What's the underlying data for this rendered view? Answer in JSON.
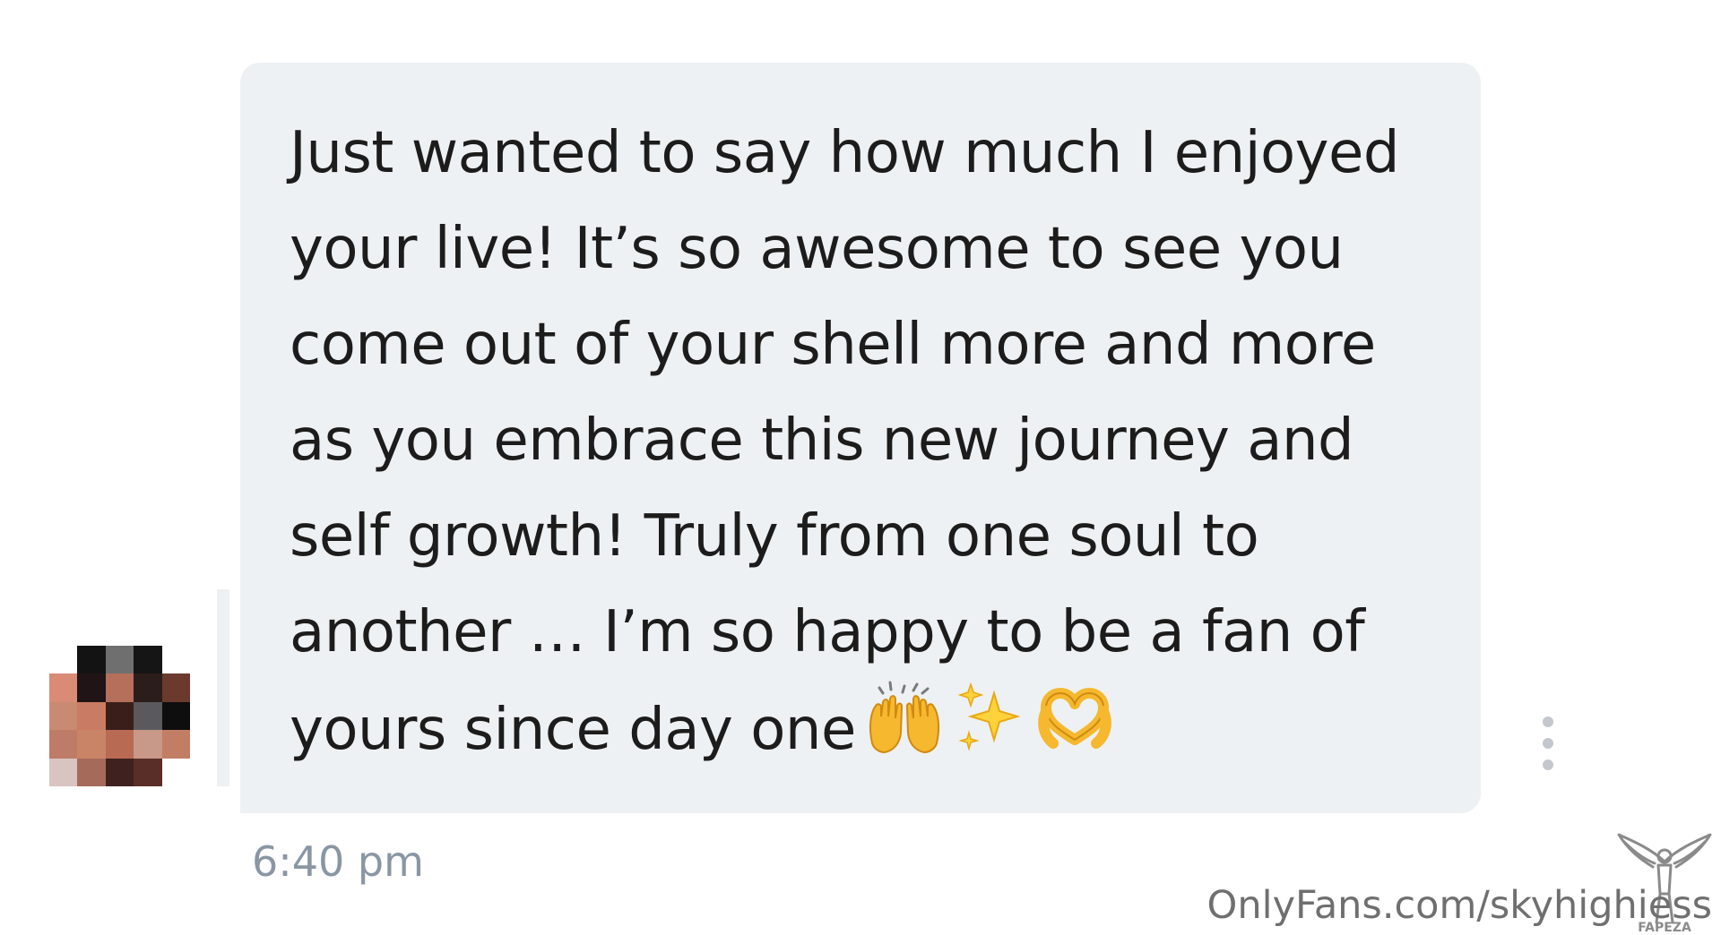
{
  "message": {
    "lines": [
      "Just wanted to say how much I enjoyed",
      "your live! It’s so awesome to see you",
      "come out of your shell more and more",
      "as you embrace this new journey and",
      "self growth! Truly from one soul to",
      "another … I’m so happy to be a fan of",
      "yours since day one"
    ],
    "emojis": [
      "raising-hands-emoji",
      "sparkles-emoji",
      "heart-hands-emoji"
    ],
    "timestamp": "6:40 pm"
  },
  "avatar": {
    "icon": "avatar-pixelated",
    "pixels": [
      [
        "#ffffff",
        "#131313",
        "#6f6f6f",
        "#151515",
        "#ffffff"
      ],
      [
        "#d98b76",
        "#201416",
        "#b56f5a",
        "#2b1d1b",
        "#6b3a2d"
      ],
      [
        "#c98a72",
        "#c97c63",
        "#3a1e1a",
        "#5a5a5e",
        "#0e0e0e"
      ],
      [
        "#bd7b68",
        "#c98468",
        "#b96a52",
        "#c89888",
        "#c27e64"
      ],
      [
        "#d8c4c0",
        "#a66a5b",
        "#3f2220",
        "#5a2e28",
        "#ffffff"
      ]
    ]
  },
  "actions": {
    "more_icon": "more-vertical-icon"
  },
  "watermark": {
    "text": "OnlyFans.com/skyhighiess",
    "logo_text": "FAPEZA"
  },
  "colors": {
    "bubble": "#eef1f3",
    "text": "#1c1c1c",
    "timestamp": "#8a96a3",
    "more_dots": "#c4c8ce",
    "watermark": "#6f6f6f"
  }
}
